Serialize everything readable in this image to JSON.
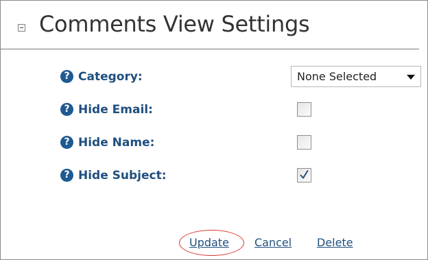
{
  "panel": {
    "title": "Comments View Settings",
    "toggle_icon": "collapse-icon"
  },
  "fields": [
    {
      "label": "Category:",
      "help_icon": "help-icon",
      "control": "select",
      "value": "None Selected"
    },
    {
      "label": "Hide Email:",
      "help_icon": "help-icon",
      "control": "checkbox",
      "checked": false
    },
    {
      "label": "Hide Name:",
      "help_icon": "help-icon",
      "control": "checkbox",
      "checked": false
    },
    {
      "label": "Hide Subject:",
      "help_icon": "help-icon",
      "control": "checkbox",
      "checked": true
    }
  ],
  "actions": {
    "update": "Update",
    "cancel": "Cancel",
    "delete": "Delete"
  },
  "colors": {
    "label": "#1f4f7e",
    "help_icon": "#1f5a92",
    "highlight": "#d9342b",
    "divider": "#7a7a7a"
  }
}
